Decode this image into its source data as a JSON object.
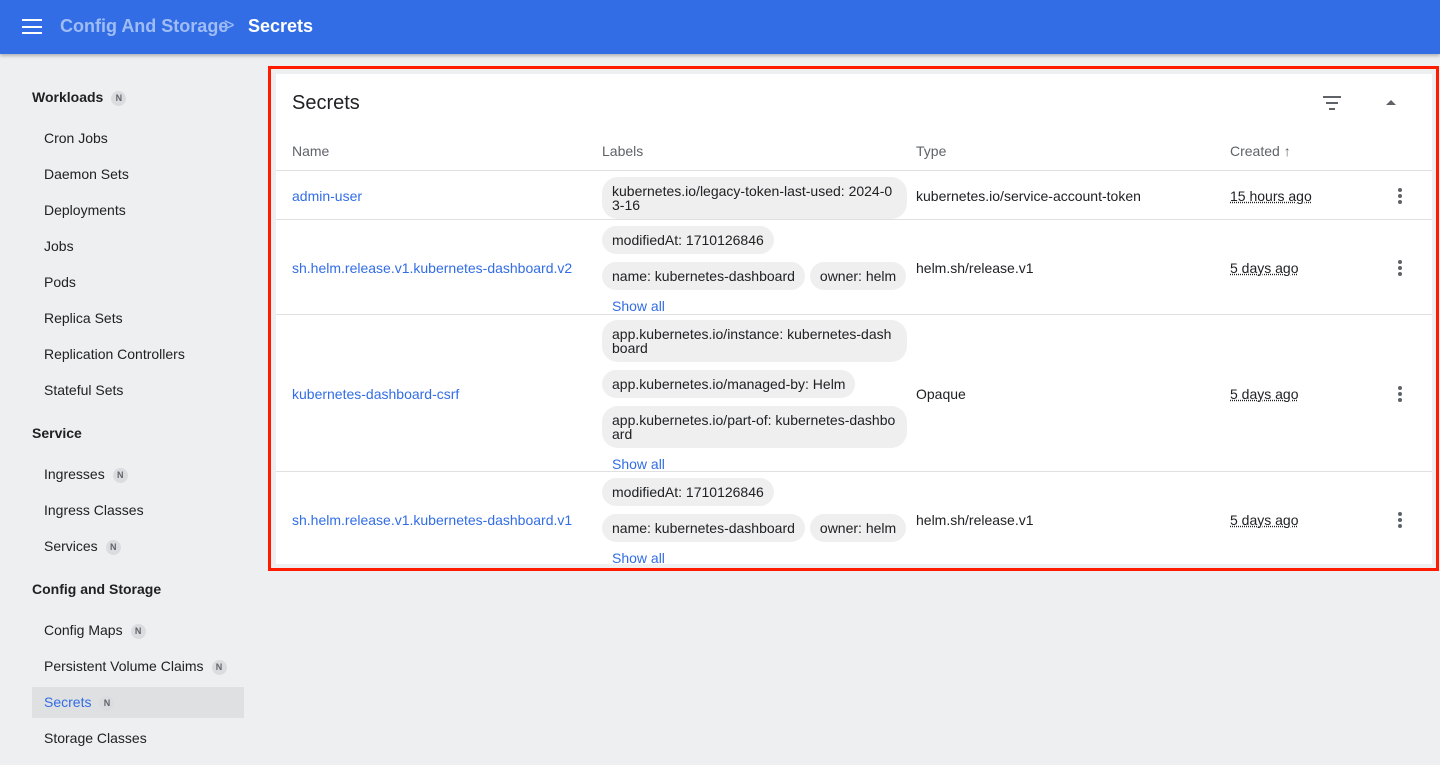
{
  "header": {
    "breadcrumb_parent": "Config And Storage",
    "separator": ">",
    "breadcrumb_current": "Secrets"
  },
  "sidebar": {
    "workloads": "Workloads",
    "workloads_badge": "N",
    "workload_items": [
      "Cron Jobs",
      "Daemon Sets",
      "Deployments",
      "Jobs",
      "Pods",
      "Replica Sets",
      "Replication Controllers",
      "Stateful Sets"
    ],
    "service": "Service",
    "service_items": [
      {
        "label": "Ingresses",
        "badge": "N"
      },
      {
        "label": "Ingress Classes"
      },
      {
        "label": "Services",
        "badge": "N"
      }
    ],
    "config": "Config and Storage",
    "config_items": [
      {
        "label": "Config Maps",
        "badge": "N"
      },
      {
        "label": "Persistent Volume Claims",
        "badge": "N"
      },
      {
        "label": "Secrets",
        "badge": "N",
        "selected": true
      },
      {
        "label": "Storage Classes"
      }
    ]
  },
  "card": {
    "title": "Secrets",
    "columns": {
      "name": "Name",
      "labels": "Labels",
      "type": "Type",
      "created": "Created",
      "sort_icon": "arrow-up"
    },
    "rows": [
      {
        "name": "admin-user",
        "labels": [
          "kubernetes.io/legacy-token-last-used: 2024-03-16"
        ],
        "type": "kubernetes.io/service-account-token",
        "created": "15 hours ago"
      },
      {
        "name": "sh.helm.release.v1.kubernetes-dashboard.v2",
        "labels": [
          "modifiedAt: 1710126846",
          "name: kubernetes-dashboard",
          "owner: helm"
        ],
        "show_all": "Show all",
        "type": "helm.sh/release.v1",
        "created": "5 days ago"
      },
      {
        "name": "kubernetes-dashboard-csrf",
        "labels": [
          "app.kubernetes.io/instance: kubernetes-dashboard",
          "app.kubernetes.io/managed-by: Helm",
          "app.kubernetes.io/part-of: kubernetes-dashboard"
        ],
        "show_all": "Show all",
        "type": "Opaque",
        "created": "5 days ago"
      },
      {
        "name": "sh.helm.release.v1.kubernetes-dashboard.v1",
        "labels": [
          "modifiedAt: 1710126846",
          "name: kubernetes-dashboard",
          "owner: helm"
        ],
        "show_all": "Show all",
        "type": "helm.sh/release.v1",
        "created": "5 days ago"
      }
    ]
  },
  "colors": {
    "primary": "#326de6",
    "highlight_outline": "#ff1a00"
  }
}
